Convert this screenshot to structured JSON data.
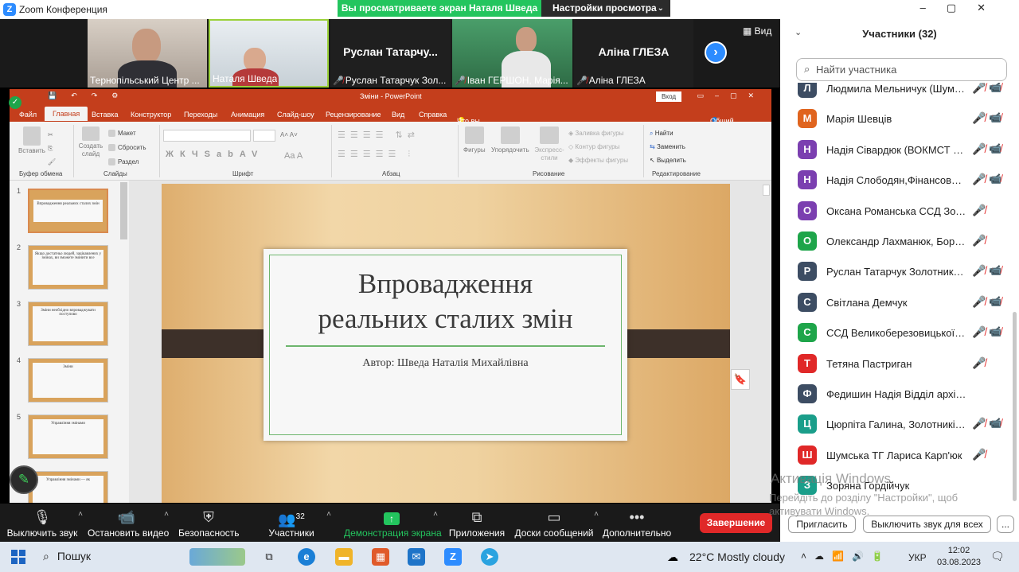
{
  "zoom": {
    "window_title": "Zoom Конференция",
    "share_banner": "Вы просматриваете экран Наталя Шведа",
    "view_settings": "Настройки просмотра",
    "view_button": "Вид"
  },
  "videos": [
    {
      "name": "Тернопільський Центр ...",
      "muted": false
    },
    {
      "name": "Наталя Шведа",
      "muted": false
    },
    {
      "name": "Руслан Татарчук Зол...",
      "big_name": "Руслан  Татарчу...",
      "muted": true
    },
    {
      "name": "Іван ГЕРШОН, Марія...",
      "muted": true
    },
    {
      "name": "Аліна ГЛЕЗА",
      "big_name": "Аліна ГЛЕЗА",
      "muted": true
    }
  ],
  "ppt": {
    "doc_title": "Зміни  -  PowerPoint",
    "login": "Вход",
    "tabs": [
      "Файл",
      "Главная",
      "Вставка",
      "Конструктор",
      "Переходы",
      "Анимация",
      "Слайд-шоу",
      "Рецензирование",
      "Вид",
      "Справка",
      "Что вы хотите сделать?",
      "Общий доступ"
    ],
    "ribbon": {
      "paste": "Вставить",
      "clipboard": "Буфер обмена",
      "create_slide": "Создать слайд",
      "layout": "Макет",
      "reset": "Сбросить",
      "section": "Раздел",
      "slides": "Слайды",
      "font": "Шрифт",
      "paragraph": "Абзац",
      "shapes": "Фигуры",
      "arrange": "Упорядочить",
      "express_styles": "Экспресс-стили",
      "shape_fill": "Заливка фигуры",
      "shape_outline": "Контур фигуры",
      "shape_effects": "Эффекты фигуры",
      "drawing": "Рисование",
      "find": "Найти",
      "replace": "Заменить",
      "select": "Выделить",
      "editing": "Редактирование"
    },
    "thumbs": [
      {
        "num": "1",
        "text": "Впровадження реальних сталих змін"
      },
      {
        "num": "2",
        "text": "Якщо достатньо людей, зацікавлених у змінах, ви зможете змінити все"
      },
      {
        "num": "3",
        "text": "Зміни необхідно впроваджувати поступово"
      },
      {
        "num": "4",
        "text": "Зміни"
      },
      {
        "num": "5",
        "text": "Управління змінами"
      },
      {
        "num": "6",
        "text": "Управління змінами — як"
      }
    ],
    "slide": {
      "title": "Впровадження\nреальних сталих змін",
      "author": "Автор: Шведа Наталія Михайлівна"
    }
  },
  "toolbar": {
    "mute": "Выключить звук",
    "video": "Остановить видео",
    "security": "Безопасность",
    "participants": "Участники",
    "participants_count": "32",
    "share": "Демонстрация экрана",
    "apps": "Приложения",
    "whiteboards": "Доски сообщений",
    "more": "Дополнительно",
    "end": "Завершение"
  },
  "panel": {
    "title": "Участники (32)",
    "search_placeholder": "Найти участника",
    "participants": [
      {
        "initial": "Л",
        "color": "#3d4d63",
        "name": "Людмила Мельничук (Шумськ)",
        "mic_off": true,
        "cam_off": true
      },
      {
        "initial": "М",
        "color": "#e0641e",
        "name": "Марія Шевців",
        "mic_off": true,
        "cam_off": true
      },
      {
        "initial": "Н",
        "color": "#7b3fb0",
        "name": "Надія Сівардюк (ВОКМСТ Зол...",
        "mic_off": true,
        "cam_off": true
      },
      {
        "initial": "Н",
        "color": "#7b3fb0",
        "name": "Надія Слободян,Фінансовий ві...",
        "mic_off": true,
        "cam_off": true
      },
      {
        "initial": "О",
        "color": "#7b3fb0",
        "name": "Оксана Романська ССД Золотнікі...",
        "mic_off": true,
        "cam_off": false
      },
      {
        "initial": "О",
        "color": "#1ea54a",
        "name": "Олександр Лахманюк, Борсуківсь...",
        "mic_off": true,
        "cam_off": false
      },
      {
        "initial": "Р",
        "color": "#3d4d63",
        "name": "Руслан Татарчук Золотники О...",
        "mic_off": true,
        "cam_off": true
      },
      {
        "initial": "С",
        "color": "#3d4d63",
        "name": "Світлана Демчук",
        "mic_off": true,
        "cam_off": true
      },
      {
        "initial": "С",
        "color": "#1ea54a",
        "name": "ССД Великоберезовицької се...",
        "mic_off": true,
        "cam_off": true
      },
      {
        "initial": "Т",
        "color": "#e02828",
        "name": "Тетяна Пастриган",
        "mic_off": true,
        "cam_off": false
      },
      {
        "initial": "Ф",
        "color": "#3d4d63",
        "name": "Федишин Надія Відділ архітектури,...",
        "mic_off": false,
        "cam_off": false
      },
      {
        "initial": "Ц",
        "color": "#1a9e8a",
        "name": "Цюрпіта Галина, Золотниківсь...",
        "mic_off": true,
        "cam_off": true
      },
      {
        "initial": "Ш",
        "color": "#e02828",
        "name": "Шумська ТГ Лариса Карп'юк",
        "mic_off": true,
        "cam_off": false
      },
      {
        "initial": "З",
        "color": "#1a9e8a",
        "name": "Зоряна Гордійчук",
        "mic_off": false,
        "cam_off": false
      }
    ],
    "invite": "Пригласить",
    "mute_all": "Выключить звук для всех",
    "more": "..."
  },
  "activation": {
    "line1": "Активація Windows",
    "line2": "Перейдіть до розділу \"Настройки\", щоб",
    "line3": "активувати Windows."
  },
  "taskbar": {
    "search": "Пошук",
    "weather": "22°C  Mostly cloudy",
    "lang": "УКР",
    "time": "12:02",
    "date": "03.08.2023"
  }
}
